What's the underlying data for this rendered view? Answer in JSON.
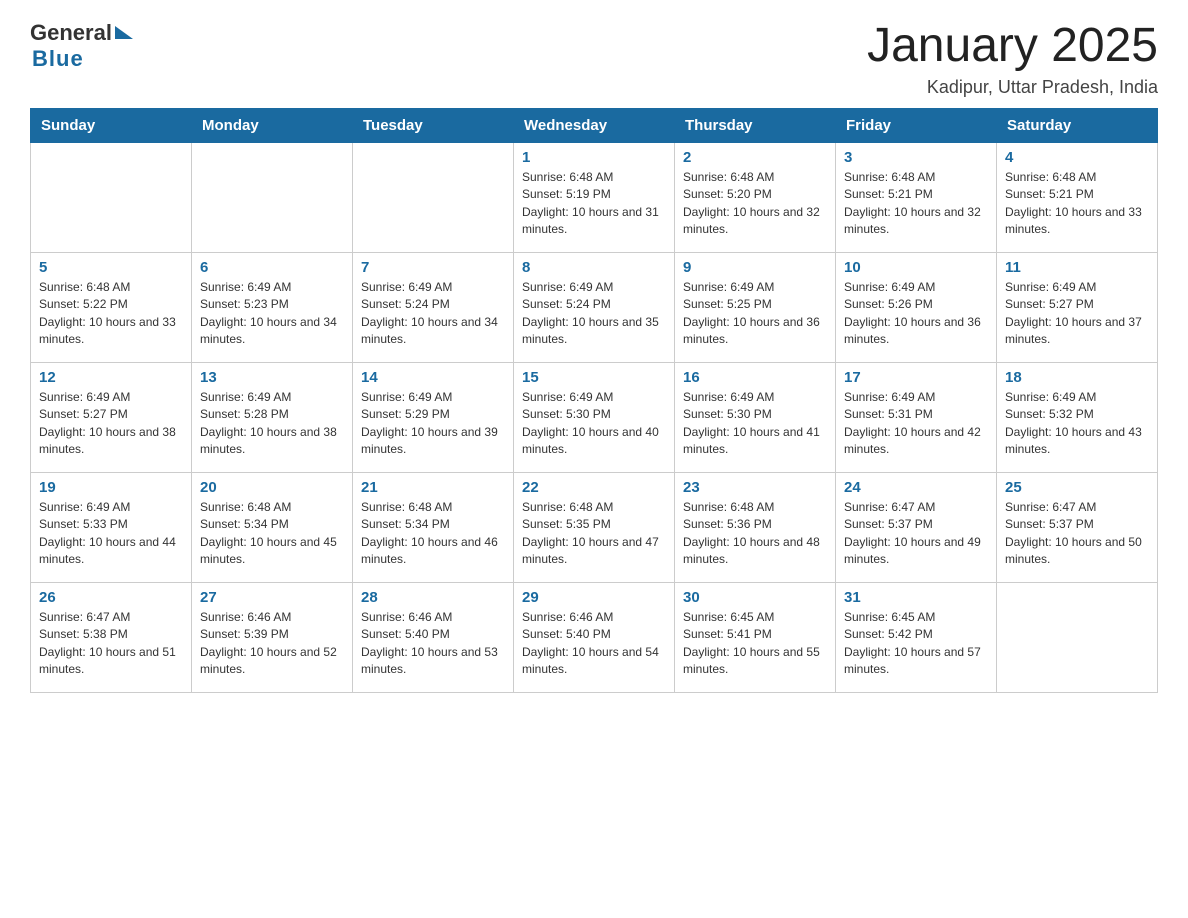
{
  "header": {
    "logo_general": "General",
    "logo_blue": "Blue",
    "title": "January 2025",
    "subtitle": "Kadipur, Uttar Pradesh, India"
  },
  "days_of_week": [
    "Sunday",
    "Monday",
    "Tuesday",
    "Wednesday",
    "Thursday",
    "Friday",
    "Saturday"
  ],
  "weeks": [
    [
      {
        "day": "",
        "info": ""
      },
      {
        "day": "",
        "info": ""
      },
      {
        "day": "",
        "info": ""
      },
      {
        "day": "1",
        "info": "Sunrise: 6:48 AM\nSunset: 5:19 PM\nDaylight: 10 hours and 31 minutes."
      },
      {
        "day": "2",
        "info": "Sunrise: 6:48 AM\nSunset: 5:20 PM\nDaylight: 10 hours and 32 minutes."
      },
      {
        "day": "3",
        "info": "Sunrise: 6:48 AM\nSunset: 5:21 PM\nDaylight: 10 hours and 32 minutes."
      },
      {
        "day": "4",
        "info": "Sunrise: 6:48 AM\nSunset: 5:21 PM\nDaylight: 10 hours and 33 minutes."
      }
    ],
    [
      {
        "day": "5",
        "info": "Sunrise: 6:48 AM\nSunset: 5:22 PM\nDaylight: 10 hours and 33 minutes."
      },
      {
        "day": "6",
        "info": "Sunrise: 6:49 AM\nSunset: 5:23 PM\nDaylight: 10 hours and 34 minutes."
      },
      {
        "day": "7",
        "info": "Sunrise: 6:49 AM\nSunset: 5:24 PM\nDaylight: 10 hours and 34 minutes."
      },
      {
        "day": "8",
        "info": "Sunrise: 6:49 AM\nSunset: 5:24 PM\nDaylight: 10 hours and 35 minutes."
      },
      {
        "day": "9",
        "info": "Sunrise: 6:49 AM\nSunset: 5:25 PM\nDaylight: 10 hours and 36 minutes."
      },
      {
        "day": "10",
        "info": "Sunrise: 6:49 AM\nSunset: 5:26 PM\nDaylight: 10 hours and 36 minutes."
      },
      {
        "day": "11",
        "info": "Sunrise: 6:49 AM\nSunset: 5:27 PM\nDaylight: 10 hours and 37 minutes."
      }
    ],
    [
      {
        "day": "12",
        "info": "Sunrise: 6:49 AM\nSunset: 5:27 PM\nDaylight: 10 hours and 38 minutes."
      },
      {
        "day": "13",
        "info": "Sunrise: 6:49 AM\nSunset: 5:28 PM\nDaylight: 10 hours and 38 minutes."
      },
      {
        "day": "14",
        "info": "Sunrise: 6:49 AM\nSunset: 5:29 PM\nDaylight: 10 hours and 39 minutes."
      },
      {
        "day": "15",
        "info": "Sunrise: 6:49 AM\nSunset: 5:30 PM\nDaylight: 10 hours and 40 minutes."
      },
      {
        "day": "16",
        "info": "Sunrise: 6:49 AM\nSunset: 5:30 PM\nDaylight: 10 hours and 41 minutes."
      },
      {
        "day": "17",
        "info": "Sunrise: 6:49 AM\nSunset: 5:31 PM\nDaylight: 10 hours and 42 minutes."
      },
      {
        "day": "18",
        "info": "Sunrise: 6:49 AM\nSunset: 5:32 PM\nDaylight: 10 hours and 43 minutes."
      }
    ],
    [
      {
        "day": "19",
        "info": "Sunrise: 6:49 AM\nSunset: 5:33 PM\nDaylight: 10 hours and 44 minutes."
      },
      {
        "day": "20",
        "info": "Sunrise: 6:48 AM\nSunset: 5:34 PM\nDaylight: 10 hours and 45 minutes."
      },
      {
        "day": "21",
        "info": "Sunrise: 6:48 AM\nSunset: 5:34 PM\nDaylight: 10 hours and 46 minutes."
      },
      {
        "day": "22",
        "info": "Sunrise: 6:48 AM\nSunset: 5:35 PM\nDaylight: 10 hours and 47 minutes."
      },
      {
        "day": "23",
        "info": "Sunrise: 6:48 AM\nSunset: 5:36 PM\nDaylight: 10 hours and 48 minutes."
      },
      {
        "day": "24",
        "info": "Sunrise: 6:47 AM\nSunset: 5:37 PM\nDaylight: 10 hours and 49 minutes."
      },
      {
        "day": "25",
        "info": "Sunrise: 6:47 AM\nSunset: 5:37 PM\nDaylight: 10 hours and 50 minutes."
      }
    ],
    [
      {
        "day": "26",
        "info": "Sunrise: 6:47 AM\nSunset: 5:38 PM\nDaylight: 10 hours and 51 minutes."
      },
      {
        "day": "27",
        "info": "Sunrise: 6:46 AM\nSunset: 5:39 PM\nDaylight: 10 hours and 52 minutes."
      },
      {
        "day": "28",
        "info": "Sunrise: 6:46 AM\nSunset: 5:40 PM\nDaylight: 10 hours and 53 minutes."
      },
      {
        "day": "29",
        "info": "Sunrise: 6:46 AM\nSunset: 5:40 PM\nDaylight: 10 hours and 54 minutes."
      },
      {
        "day": "30",
        "info": "Sunrise: 6:45 AM\nSunset: 5:41 PM\nDaylight: 10 hours and 55 minutes."
      },
      {
        "day": "31",
        "info": "Sunrise: 6:45 AM\nSunset: 5:42 PM\nDaylight: 10 hours and 57 minutes."
      },
      {
        "day": "",
        "info": ""
      }
    ]
  ]
}
